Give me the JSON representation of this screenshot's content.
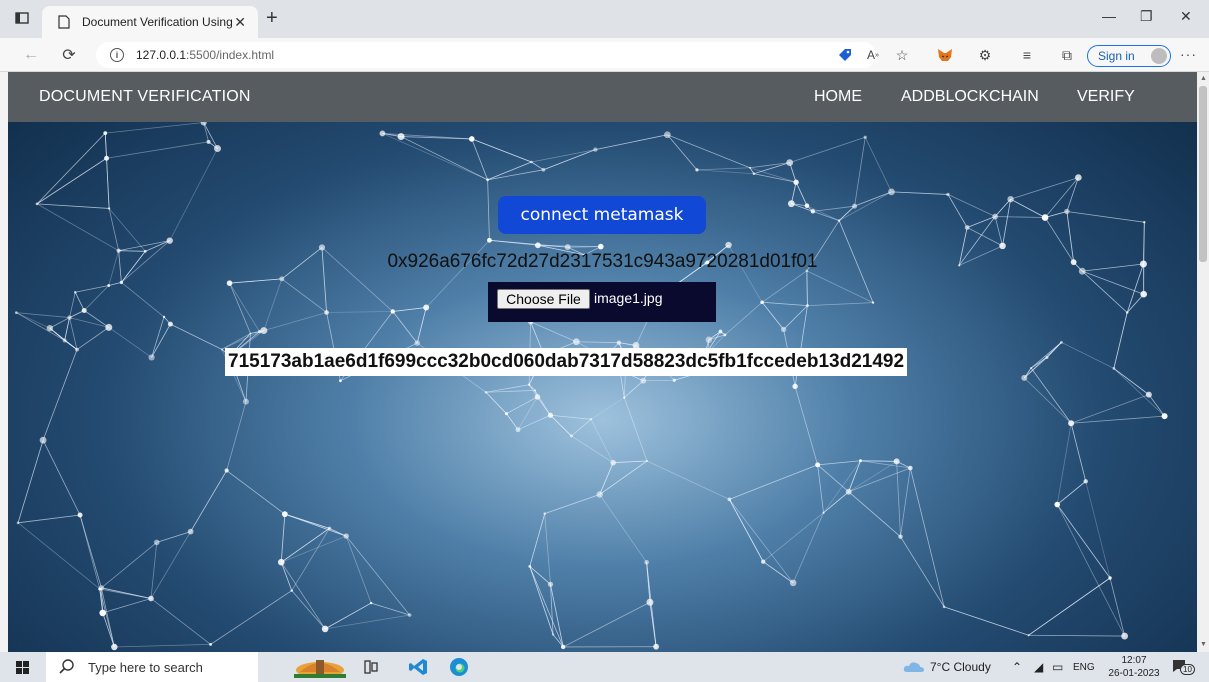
{
  "browser": {
    "tab_title": "Document Verification Using Blo",
    "url_host": "127.0.0.1",
    "url_rest": ":5500/index.html",
    "signin_label": "Sign in",
    "accent_color": "#1a73e8"
  },
  "page": {
    "brand": "DOCUMENT VERIFICATION",
    "nav": [
      "HOME",
      "ADDBLOCKCHAIN",
      "VERIFY"
    ],
    "connect_button": "connect metamask",
    "account_address": "0x926a676fc72d27d2317531c943a9720281d01f01",
    "choose_file_label": "Choose File",
    "selected_file": "image1.jpg",
    "document_hash": "715173ab1ae6d1f699ccc32b0cd060dab7317d58823dc5fb1fccedeb13d21492",
    "navbar_color": "#565c60",
    "button_color": "#1148d6"
  },
  "taskbar": {
    "search_placeholder": "Type here to search",
    "weather": "7°C  Cloudy",
    "language": "ENG",
    "time": "12:07",
    "date": "26-01-2023",
    "notification_count": "10"
  }
}
